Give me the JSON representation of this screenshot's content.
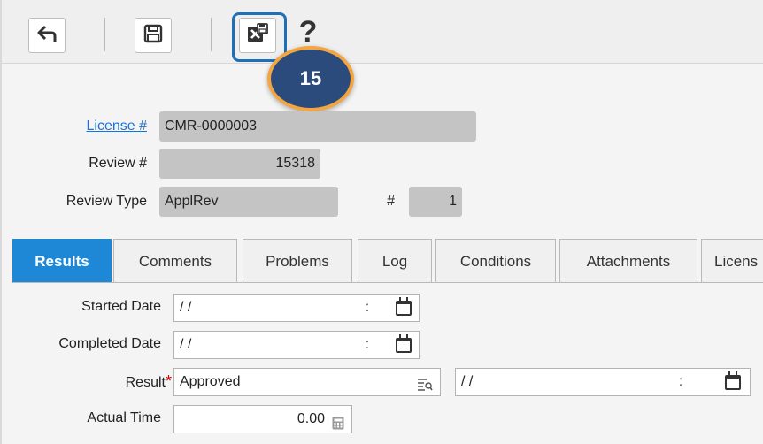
{
  "toolbar": {
    "buttons": [
      {
        "name": "undo",
        "icon": "undo-arrow-icon"
      },
      {
        "name": "save",
        "icon": "floppy-disk-icon"
      },
      {
        "name": "save-close",
        "icon": "save-close-icon"
      }
    ],
    "help_label": "?",
    "step_badge": "15",
    "highlight_color": "#1f6fb8",
    "badge_color": "#2a4b7c",
    "badge_ring_color": "#f2a541"
  },
  "header": {
    "license_label": "License #",
    "license_value": "CMR-0000003",
    "review_label": "Review #",
    "review_value": "15318",
    "review_type_label": "Review Type",
    "review_type_value": "ApplRev",
    "seq_label": "#",
    "seq_value": "1"
  },
  "tabs": [
    {
      "label": "Results",
      "active": true
    },
    {
      "label": "Comments",
      "active": false
    },
    {
      "label": "Problems",
      "active": false
    },
    {
      "label": "Log",
      "active": false
    },
    {
      "label": "Conditions",
      "active": false
    },
    {
      "label": "Attachments",
      "active": false
    },
    {
      "label": "Licens",
      "active": false
    }
  ],
  "results": {
    "started_label": "Started Date",
    "started_date": "/ /",
    "started_time": ":",
    "completed_label": "Completed Date",
    "completed_date": "/ /",
    "completed_time": ":",
    "result_label": "Result",
    "required_mark": "*",
    "result_value": "Approved",
    "result_date": "/ /",
    "result_time": ":",
    "actual_time_label": "Actual Time",
    "actual_time_value": "0.00"
  },
  "colors": {
    "active_tab": "#1f88d6",
    "link": "#1a73d9",
    "readonly_field": "#c4c4c4"
  }
}
